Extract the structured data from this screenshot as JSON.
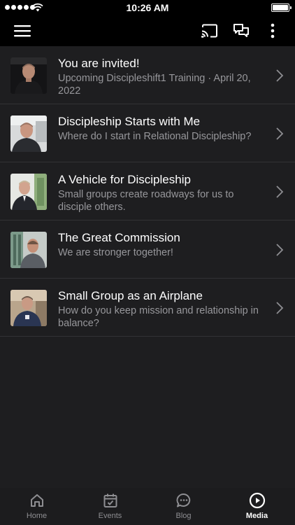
{
  "status_bar": {
    "time": "10:26 AM"
  },
  "app_bar": {
    "menu_icon": "hamburger-menu-icon",
    "cast_icon": "cast-icon",
    "chat_icon": "chat-bubbles-icon",
    "more_icon": "more-vertical-icon"
  },
  "media_items": [
    {
      "title": "You are invited!",
      "subtitle": "Upcoming Discipleshift1 Training · April 20, 2022"
    },
    {
      "title": "Discipleship Starts with Me",
      "subtitle": "Where do I start in Relational Discipleship?"
    },
    {
      "title": "A Vehicle for Discipleship",
      "subtitle": "Small groups create roadways for us to disciple others."
    },
    {
      "title": "The Great Commission",
      "subtitle": "We are stronger together!"
    },
    {
      "title": "Small Group as an Airplane",
      "subtitle": "How do you keep mission and relationship in balance?"
    }
  ],
  "tabs": [
    {
      "label": "Home",
      "icon": "home-icon",
      "active": false
    },
    {
      "label": "Events",
      "icon": "calendar-check-icon",
      "active": false
    },
    {
      "label": "Blog",
      "icon": "chat-dots-icon",
      "active": false
    },
    {
      "label": "Media",
      "icon": "play-circle-icon",
      "active": true
    }
  ],
  "colors": {
    "background": "#1e1e20",
    "bar": "#000000",
    "divider": "#323235",
    "subtitle": "#97979b",
    "tab_inactive": "#8e8e92",
    "tab_active": "#ffffff"
  }
}
